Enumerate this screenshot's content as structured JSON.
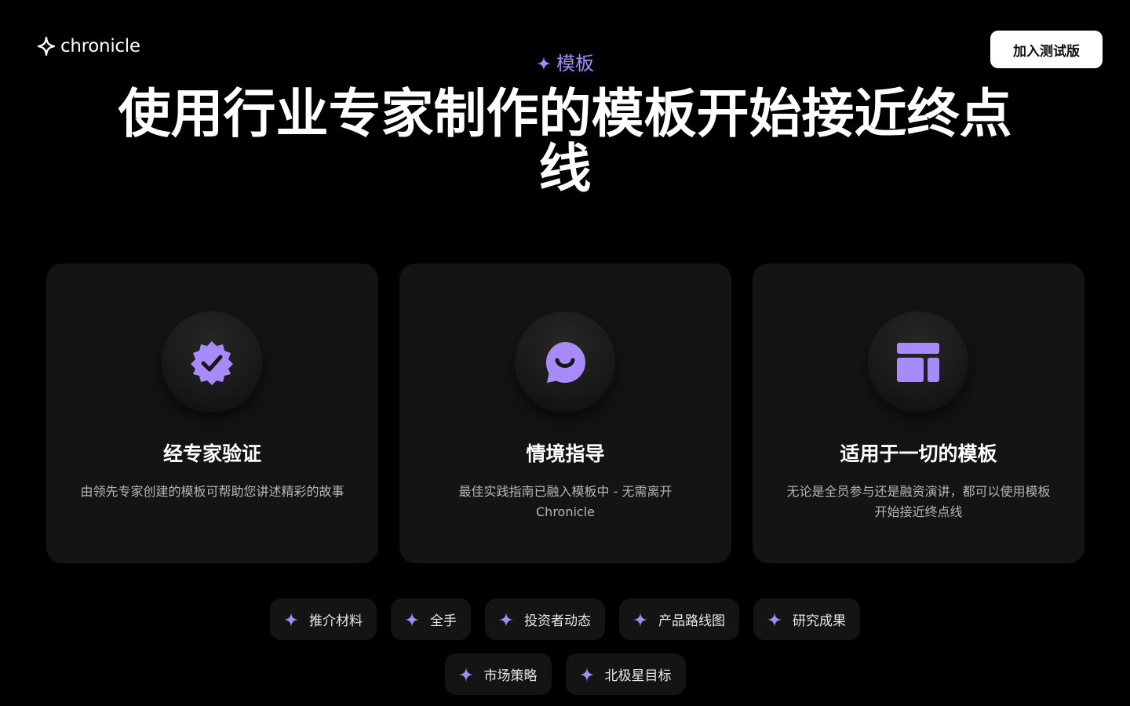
{
  "header": {
    "logo_text": "chronicle",
    "logo_icon": "sparkle-icon",
    "cta_label": "加入测试版"
  },
  "hero": {
    "eyebrow": "模板",
    "eyebrow_icon": "sparkle-icon",
    "title": "使用行业专家制作的模板开始接近终点线"
  },
  "cards": [
    {
      "icon": "verified-badge-icon",
      "title": "经专家验证",
      "description": "由领先专家创建的模板可帮助您讲述精彩的故事"
    },
    {
      "icon": "chat-smile-icon",
      "title": "情境指导",
      "description": "最佳实践指南已融入模板中 - 无需离开 Chronicle"
    },
    {
      "icon": "layout-template-icon",
      "title": "适用于一切的模板",
      "description": "无论是全员参与还是融资演讲，都可以使用模板开始接近终点线"
    }
  ],
  "tags": {
    "row1": [
      "推介材料",
      "全手",
      "投资者动态",
      "产品路线图",
      "研究成果"
    ],
    "row2": [
      "市场策略",
      "北极星目标"
    ]
  },
  "colors": {
    "background": "#000000",
    "accent": "#a78bfa",
    "card_bg": "#141414",
    "button_bg": "#ffffff"
  }
}
